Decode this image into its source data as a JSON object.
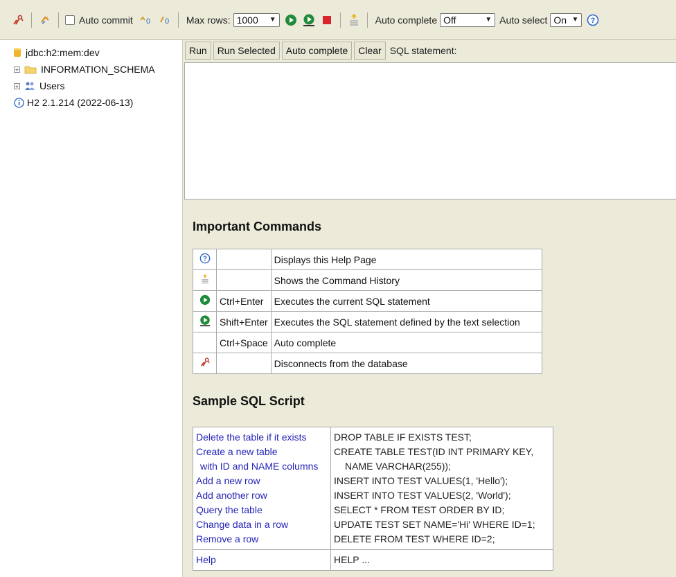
{
  "toolbar": {
    "auto_commit_label": "Auto commit",
    "max_rows_label": "Max rows:",
    "max_rows_value": "1000",
    "auto_complete_label": "Auto complete",
    "auto_complete_value": "Off",
    "auto_select_label": "Auto select",
    "auto_select_value": "On"
  },
  "tree": {
    "connection": "jdbc:h2:mem:dev",
    "items": [
      {
        "label": "INFORMATION_SCHEMA",
        "icon": "folder-icon"
      },
      {
        "label": "Users",
        "icon": "users-icon"
      }
    ],
    "version": "H2 2.1.214 (2022-06-13)"
  },
  "sql_toolbar": {
    "run": "Run",
    "run_selected": "Run Selected",
    "auto_complete": "Auto complete",
    "clear": "Clear",
    "statement_label": "SQL statement:"
  },
  "important_commands": {
    "title": "Important Commands",
    "rows": [
      {
        "icon": "help-icon",
        "key": "",
        "description": "Displays this Help Page"
      },
      {
        "icon": "history-icon",
        "key": "",
        "description": "Shows the Command History"
      },
      {
        "icon": "run-icon",
        "key": "Ctrl+Enter",
        "description": "Executes the current SQL statement"
      },
      {
        "icon": "run-selected-icon",
        "key": "Shift+Enter",
        "description": "Executes the SQL statement defined by the text selection"
      },
      {
        "icon": "",
        "key": "Ctrl+Space",
        "description": "Auto complete"
      },
      {
        "icon": "disconnect-icon",
        "key": "",
        "description": "Disconnects from the database"
      }
    ]
  },
  "sample_script": {
    "title": "Sample SQL Script",
    "links": {
      "delete": "Delete the table if it exists",
      "create_1": "Create a new table",
      "create_2": "with ID and NAME columns",
      "add_row": "Add a new row",
      "add_another": "Add another row",
      "query": "Query the table",
      "change": "Change data in a row",
      "remove": "Remove a row",
      "help": "Help"
    },
    "sql": {
      "delete": "DROP TABLE IF EXISTS TEST;",
      "create_1": "CREATE TABLE TEST(ID INT PRIMARY KEY,",
      "create_2": "NAME VARCHAR(255));",
      "add_row": "INSERT INTO TEST VALUES(1, 'Hello');",
      "add_another": "INSERT INTO TEST VALUES(2, 'World');",
      "query": "SELECT * FROM TEST ORDER BY ID;",
      "change": "UPDATE TEST SET NAME='Hi' WHERE ID=1;",
      "remove": "DELETE FROM TEST WHERE ID=2;",
      "help": "HELP ..."
    }
  },
  "colors": {
    "panel_bg": "#ecead9",
    "link": "#2424b8",
    "run_green": "#1f8a3b",
    "stop_red": "#d9232e",
    "disconnect_red": "#c0392b"
  }
}
